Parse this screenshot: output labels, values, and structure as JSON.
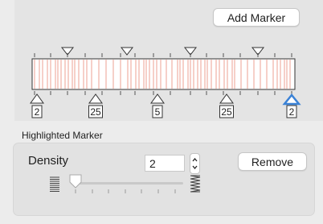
{
  "toolbar": {
    "add_marker_label": "Add Marker"
  },
  "ruler": {
    "marker_values": [
      "2",
      "25",
      "5",
      "25",
      "2"
    ],
    "selected_marker_index": 4,
    "accent_color": "#3b82d6",
    "stripe_color": "#e8836f"
  },
  "highlighted": {
    "section_label": "Highlighted Marker",
    "density_label": "Density",
    "density_value": "2",
    "remove_label": "Remove"
  }
}
